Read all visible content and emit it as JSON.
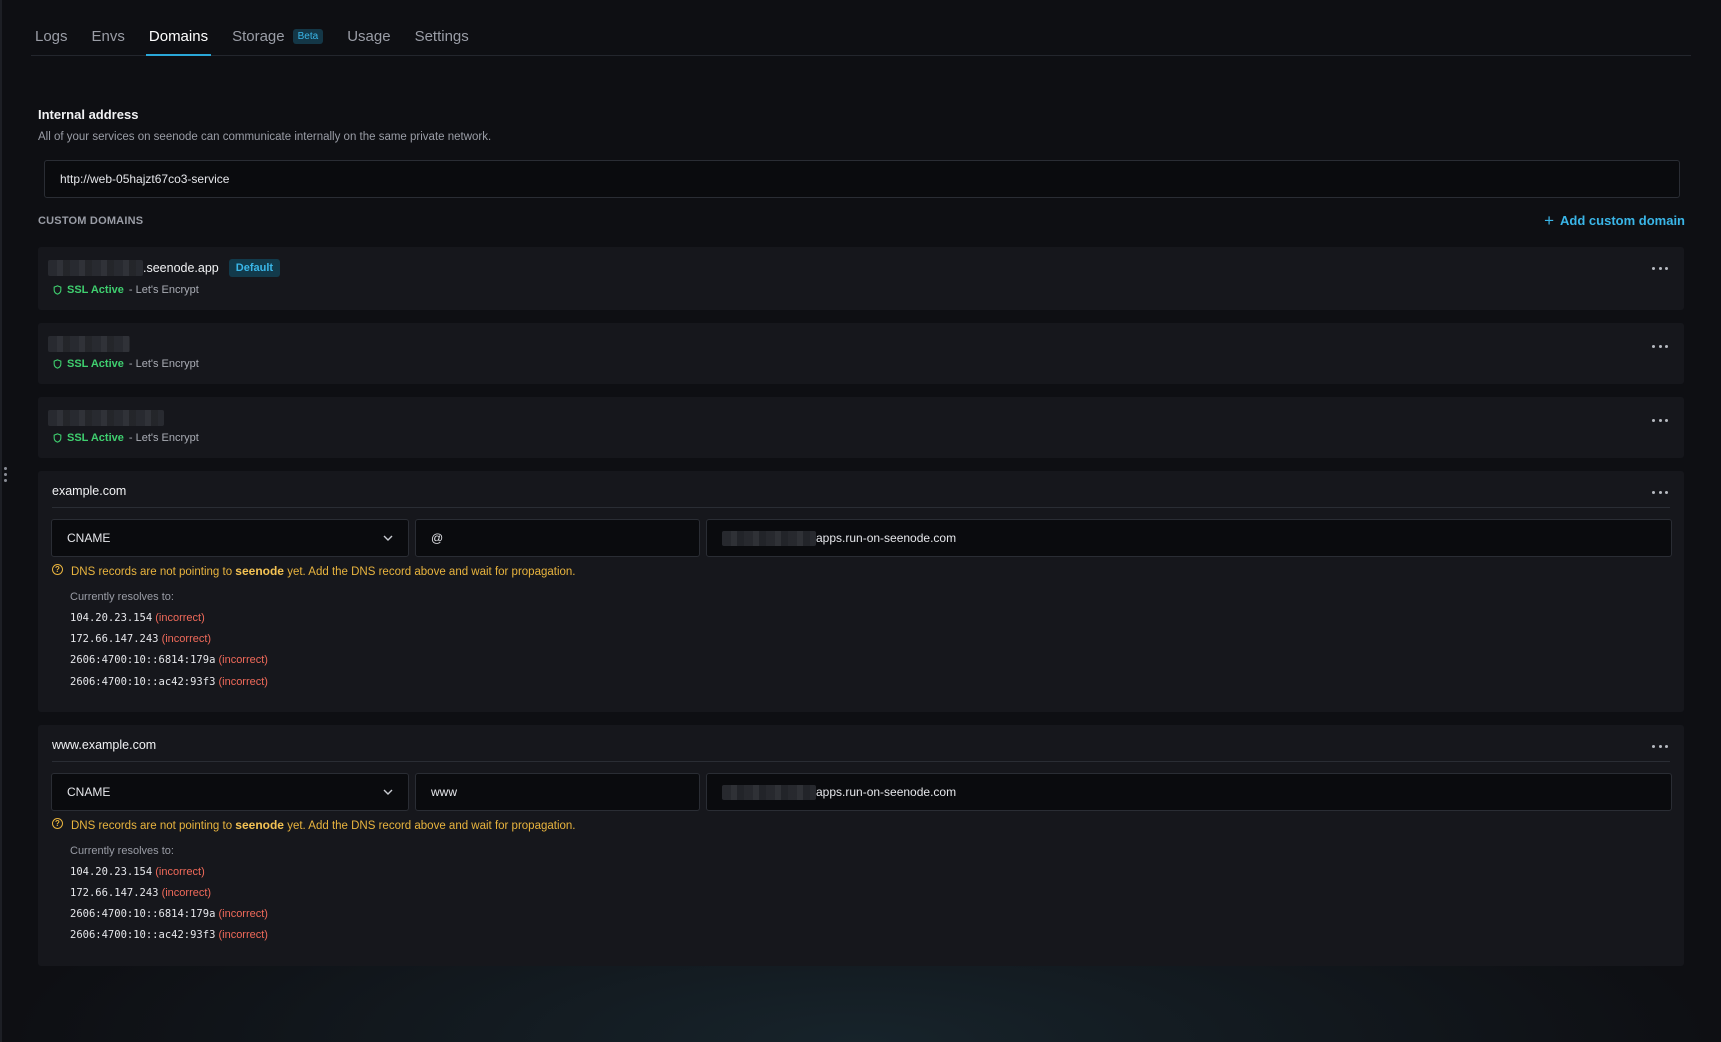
{
  "tabs": [
    {
      "label": "Logs",
      "active": false
    },
    {
      "label": "Envs",
      "active": false
    },
    {
      "label": "Domains",
      "active": true
    },
    {
      "label": "Storage",
      "active": false,
      "badge": "Beta"
    },
    {
      "label": "Usage",
      "active": false
    },
    {
      "label": "Settings",
      "active": false
    }
  ],
  "internal": {
    "title": "Internal address",
    "description": "All of your services on seenode can communicate internally on the same private network.",
    "address": "http://web-05hajzt67co3-service"
  },
  "custom_domains": {
    "header": "CUSTOM DOMAINS",
    "add_label": "Add custom domain",
    "domains": [
      {
        "suffix": ".seenode.app",
        "badge": "Default",
        "ssl_status": "SSL Active",
        "ssl_provider": "- Let's Encrypt"
      },
      {
        "suffix": "",
        "ssl_status": "SSL Active",
        "ssl_provider": "- Let's Encrypt"
      },
      {
        "suffix": "",
        "ssl_status": "SSL Active",
        "ssl_provider": "- Let's Encrypt"
      }
    ]
  },
  "dns_records": [
    {
      "domain": "example.com",
      "type": "CNAME",
      "name": "@",
      "target_suffix": "apps.run-on-seenode.com",
      "warning_prefix": "DNS records are not pointing to",
      "warning_brand": "seenode",
      "warning_suffix": "yet. Add the DNS record above and wait for propagation.",
      "resolves_label": "Currently resolves to:",
      "resolves": [
        {
          "ip": "104.20.23.154",
          "status": "(incorrect)"
        },
        {
          "ip": "172.66.147.243",
          "status": "(incorrect)"
        },
        {
          "ip": "2606:4700:10::6814:179a",
          "status": "(incorrect)"
        },
        {
          "ip": "2606:4700:10::ac42:93f3",
          "status": "(incorrect)"
        }
      ]
    },
    {
      "domain": "www.example.com",
      "type": "CNAME",
      "name": "www",
      "target_suffix": "apps.run-on-seenode.com",
      "warning_prefix": "DNS records are not pointing to",
      "warning_brand": "seenode",
      "warning_suffix": "yet. Add the DNS record above and wait for propagation.",
      "resolves_label": "Currently resolves to:",
      "resolves": [
        {
          "ip": "104.20.23.154",
          "status": "(incorrect)"
        },
        {
          "ip": "172.66.147.243",
          "status": "(incorrect)"
        },
        {
          "ip": "2606:4700:10::6814:179a",
          "status": "(incorrect)"
        },
        {
          "ip": "2606:4700:10::ac42:93f3",
          "status": "(incorrect)"
        }
      ]
    }
  ],
  "icons": {
    "menu": "more-horizontal-icon",
    "shield": "shield-icon",
    "chevron": "chevron-down-icon",
    "warning": "help-circle-icon",
    "plus": "plus-icon"
  },
  "colors": {
    "accent": "#3ab6e8",
    "ssl_active": "#3fcf6f",
    "warning": "#e9b43e",
    "incorrect": "#f06a5a"
  }
}
